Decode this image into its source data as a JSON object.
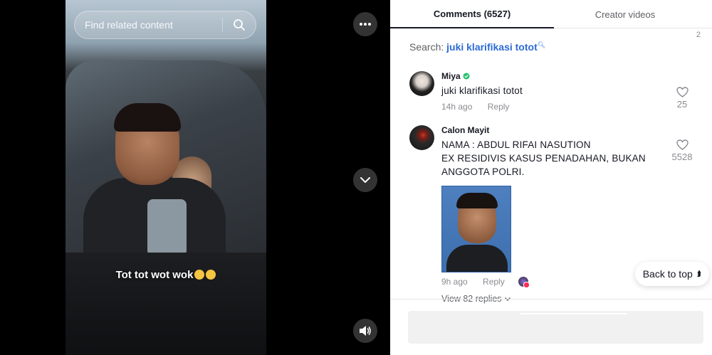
{
  "video": {
    "search_placeholder": "Find related content",
    "caption": "Tot tot wot wok",
    "caption_emojis": [
      "grinning-sweat-emoji",
      "grinning-emoji"
    ]
  },
  "tabs": [
    {
      "label": "Comments (6527)",
      "active": true
    },
    {
      "label": "Creator videos",
      "active": false
    }
  ],
  "top_right_count": "2",
  "search": {
    "prefix": "Search:",
    "query": "juki klarifikasi totot"
  },
  "comments": [
    {
      "user": "Miya",
      "verified_badge": true,
      "text": "juki klarifikasi totot",
      "time": "14h ago",
      "reply_label": "Reply",
      "likes": "25"
    },
    {
      "user": "Calon Mayit",
      "text_lines": [
        "NAMA : ABDUL RIFAI NASUTION",
        "EX RESIDIVIS KASUS PENADAHAN, BUKAN",
        "ANGGOTA POLRI."
      ],
      "time": "9h ago",
      "reply_label": "Reply",
      "likes": "5528",
      "view_replies": "View 82 replies"
    }
  ],
  "back_to_top": "Back to top",
  "colors": {
    "accent_link": "#2c6bd6",
    "text_primary": "#161823",
    "text_secondary": "#8a8b91",
    "badge_green": "#25c16f"
  }
}
